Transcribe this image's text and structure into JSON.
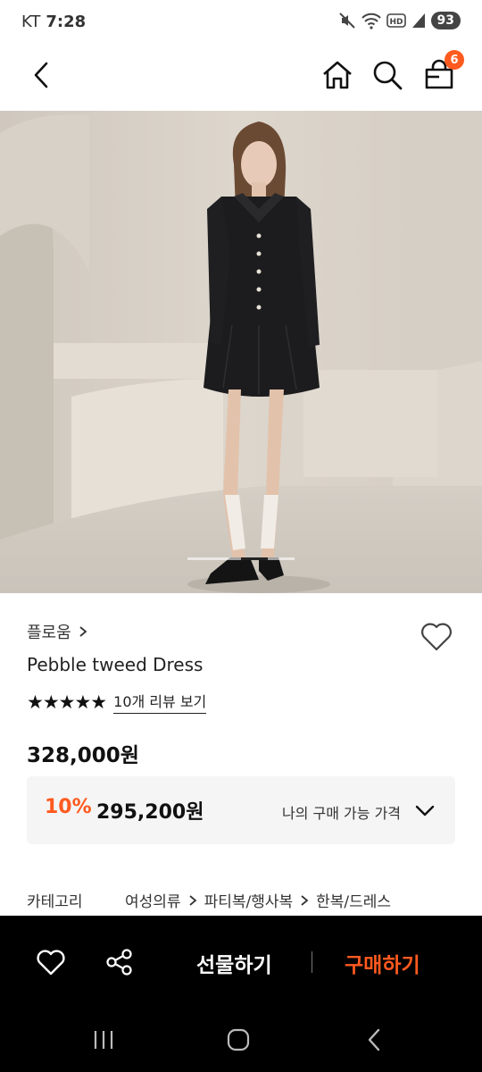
{
  "status_bar": {
    "carrier": "KT",
    "time": "7:28",
    "battery": "93",
    "icons": [
      "mute-icon",
      "wifi-icon",
      "hd-icon",
      "signal-icon"
    ]
  },
  "header": {
    "back_icon": "chevron-left-icon",
    "home_icon": "home-icon",
    "search_icon": "search-icon",
    "cart_icon": "shopping-bag-icon",
    "cart_count": "6"
  },
  "product": {
    "brand": "플로움",
    "name": "Pebble tweed Dress",
    "rating_stars": "★★★★★",
    "rating_value": 5,
    "review_link": "10개 리뷰 보기",
    "price": "328,000원",
    "discount_rate": "10%",
    "discount_price": "295,200원",
    "my_price_label": "나의 구매 가능 가격",
    "category_label": "카테고리",
    "category_path": [
      "여성의류",
      "파티복/행사복",
      "한복/드레스"
    ],
    "carousel_position": 0.5
  },
  "action_bar": {
    "gift_label": "선물하기",
    "buy_label": "구매하기"
  },
  "colors": {
    "accent": "#ff5a1f",
    "action_bar_bg": "#000000",
    "discount_box_bg": "#f5f5f5"
  }
}
